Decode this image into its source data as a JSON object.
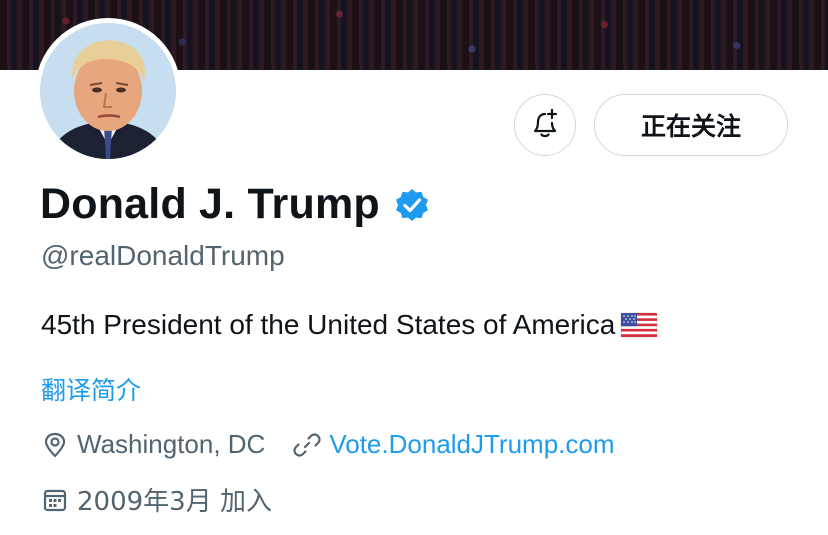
{
  "profile": {
    "name": "Donald J. Trump",
    "handle": "@realDonaldTrump",
    "bio": "45th President of the United States of America",
    "translate_label": "翻译简介",
    "location": "Washington, DC",
    "website": "Vote.DonaldJTrump.com",
    "joined": "2009年3月 加入",
    "verified": true
  },
  "actions": {
    "follow_label": "正在关注",
    "notify_icon": "bell-plus-icon"
  },
  "colors": {
    "accent": "#1d9bf0",
    "secondary_text": "#536471",
    "primary_text": "#0f1419",
    "border": "#cfd9de"
  }
}
